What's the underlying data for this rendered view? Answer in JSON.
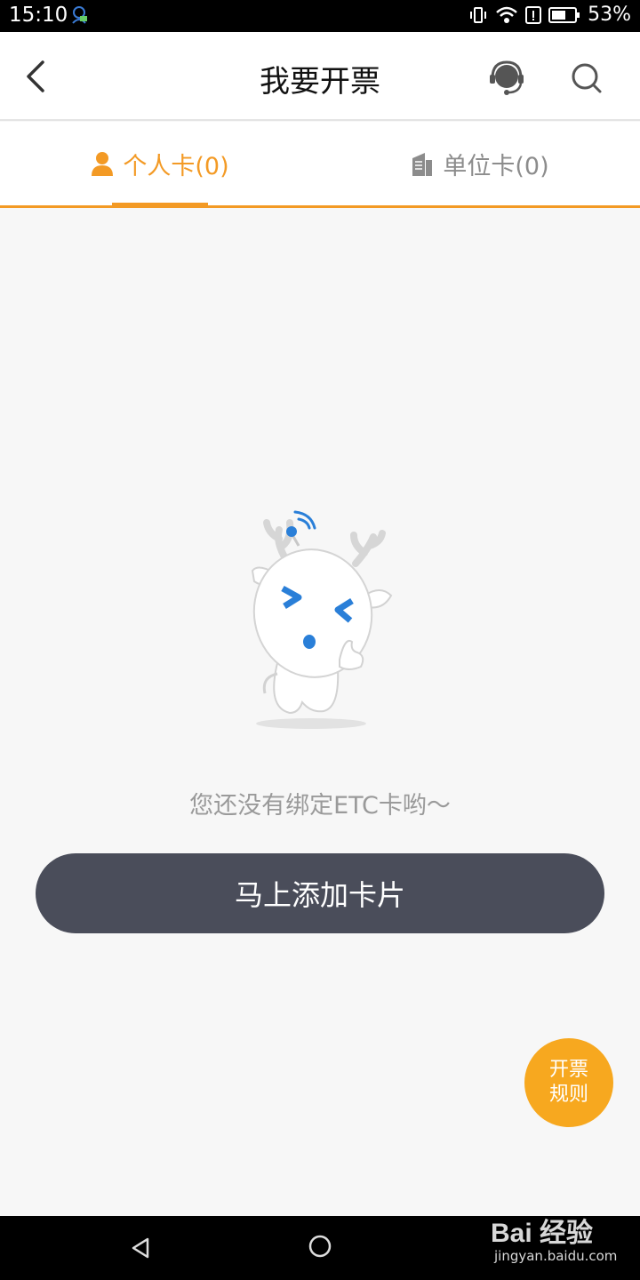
{
  "status_bar": {
    "time": "15:10",
    "battery": "53%"
  },
  "header": {
    "title": "我要开票"
  },
  "tabs": [
    {
      "label": "个人卡(0)",
      "active": true
    },
    {
      "label": "单位卡(0)",
      "active": false
    }
  ],
  "empty_state": {
    "message": "您还没有绑定ETC卡哟～"
  },
  "actions": {
    "add_card_label": "马上添加卡片",
    "rules_line1": "开票",
    "rules_line2": "规则"
  },
  "watermark": {
    "logo": "Bai 经验",
    "url": "jingyan.baidu.com"
  },
  "colors": {
    "accent": "#f39a25",
    "button_dark": "#4a4d5a",
    "rules_fab": "#f7a81f"
  }
}
